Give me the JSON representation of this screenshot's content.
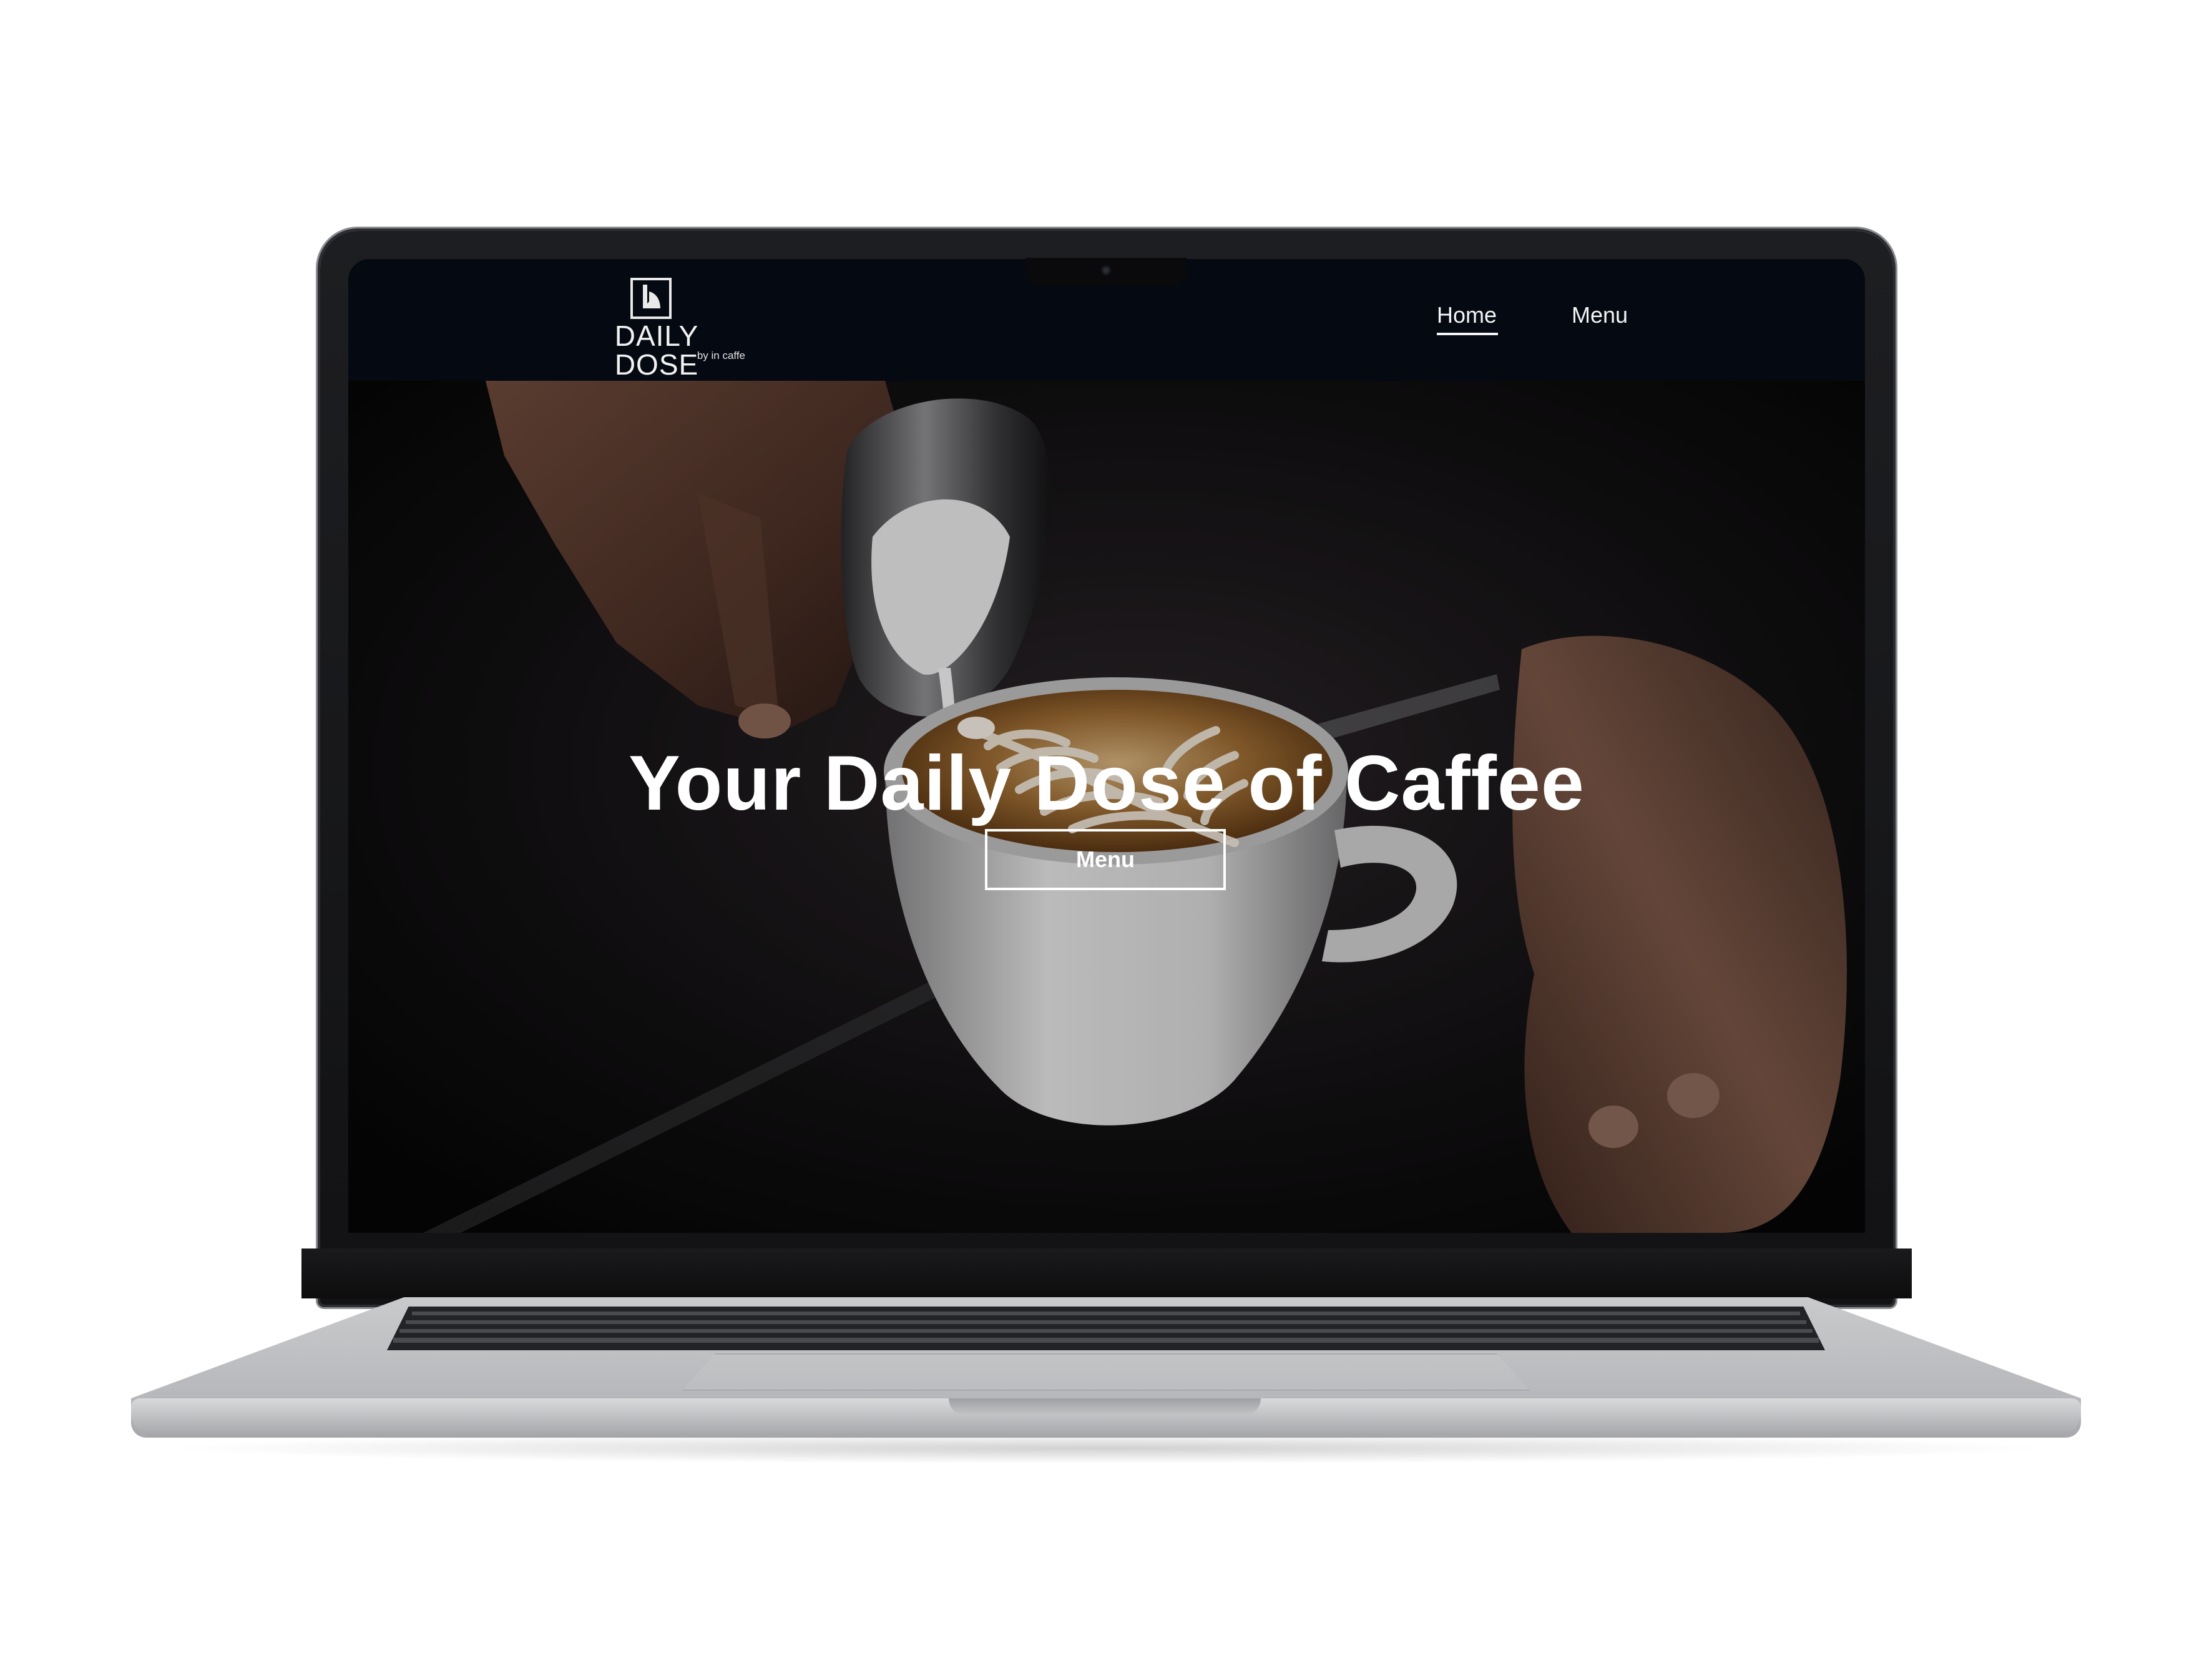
{
  "site": {
    "logo": {
      "title": "DAILY DOSE",
      "subtitle": "by in caffe"
    },
    "nav": {
      "home_label": "Home",
      "menu_label": "Menu",
      "active": "Home"
    },
    "hero": {
      "title": "Your Daily Dose of Caffee",
      "button_label": "Menu"
    },
    "colors": {
      "header_background": "#050912",
      "text": "#ffffff",
      "latte_crema": "#9a6a32"
    }
  },
  "device": {
    "type": "laptop"
  }
}
